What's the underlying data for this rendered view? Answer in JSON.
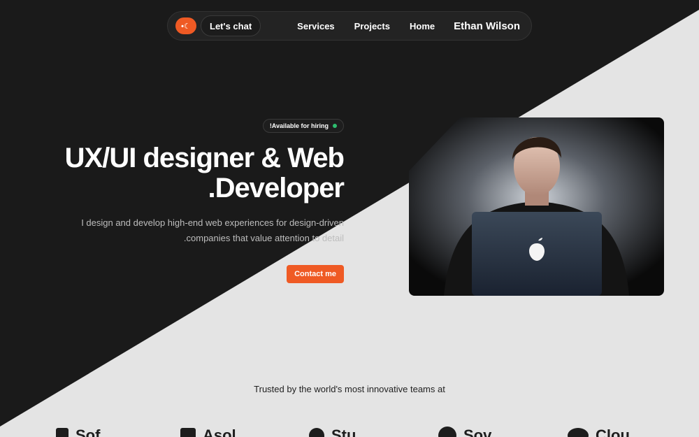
{
  "nav": {
    "logo_glyph": "•☾",
    "chat_label": "Let's chat",
    "links": [
      "Services",
      "Projects",
      "Home"
    ],
    "name": "Ethan Wilson"
  },
  "hero": {
    "badge": "!Available for hiring",
    "title_line1": "UX/UI designer & Web",
    "title_line2": ".Developer",
    "sub_line1": "I design and develop high-end web experiences for design-driven",
    "sub_line2": ".companies that value attention to detail",
    "cta": "Contact me"
  },
  "trusted": {
    "heading": "Trusted by the world's most innovative teams at",
    "logos": [
      "Sof",
      "Asol",
      "Stu",
      "Sov",
      "Clou"
    ]
  },
  "colors": {
    "accent": "#ef5a24",
    "dark_bg": "#1a1a1a",
    "light_bg": "#e4e4e4",
    "status_green": "#2dbd6e"
  }
}
